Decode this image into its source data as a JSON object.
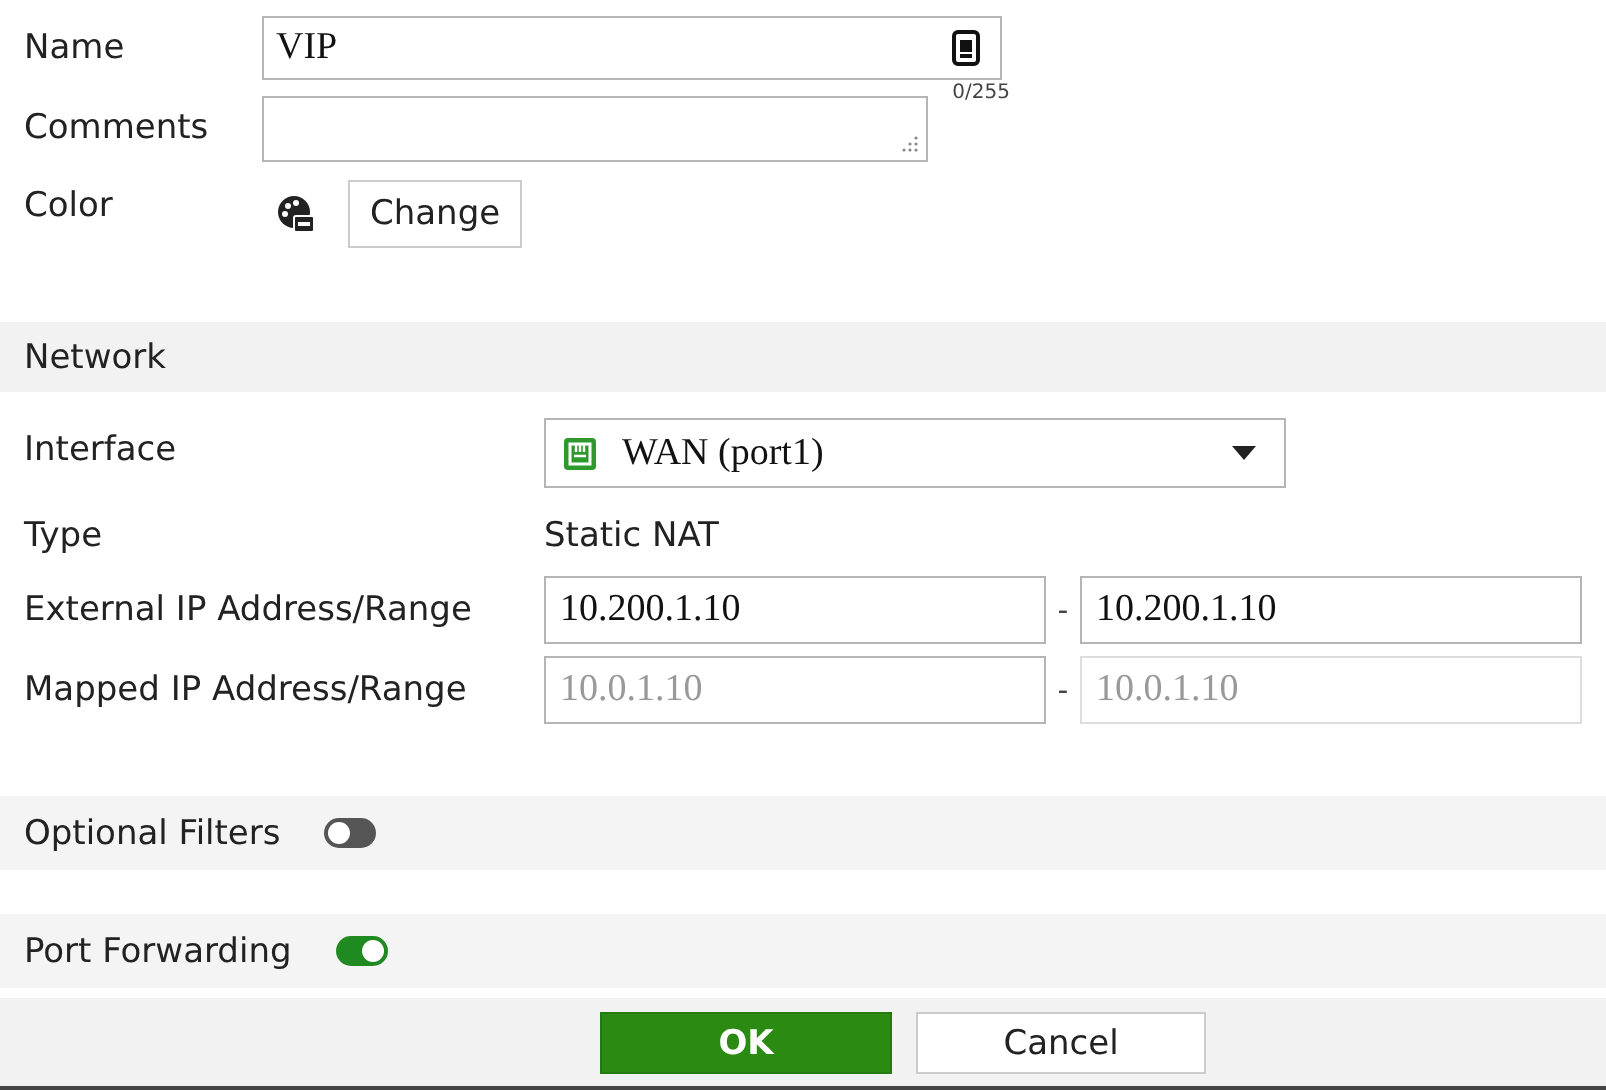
{
  "general": {
    "name": {
      "label": "Name",
      "value": "VIP",
      "counter": "0/255"
    },
    "comments": {
      "label": "Comments"
    },
    "color": {
      "label": "Color",
      "button": "Change"
    }
  },
  "network": {
    "title": "Network",
    "interface": {
      "label": "Interface",
      "value": "WAN (port1)"
    },
    "type": {
      "label": "Type",
      "value": "Static NAT"
    },
    "ranges": [
      {
        "label": "External IP Address/Range",
        "start": "10.200.1.10",
        "separator": "-",
        "end": "10.200.1.10",
        "disabled": false
      },
      {
        "label": "Mapped IP Address/Range",
        "start": "10.0.1.10",
        "separator": "-",
        "end": "10.0.1.10",
        "disabled": true
      }
    ]
  },
  "toggles": [
    {
      "label": "Optional Filters",
      "on": false
    },
    {
      "label": "Port Forwarding",
      "on": true
    }
  ],
  "buttons": [
    {
      "label": "OK",
      "kind": "primary"
    },
    {
      "label": "Cancel",
      "kind": "secondary"
    }
  ]
}
